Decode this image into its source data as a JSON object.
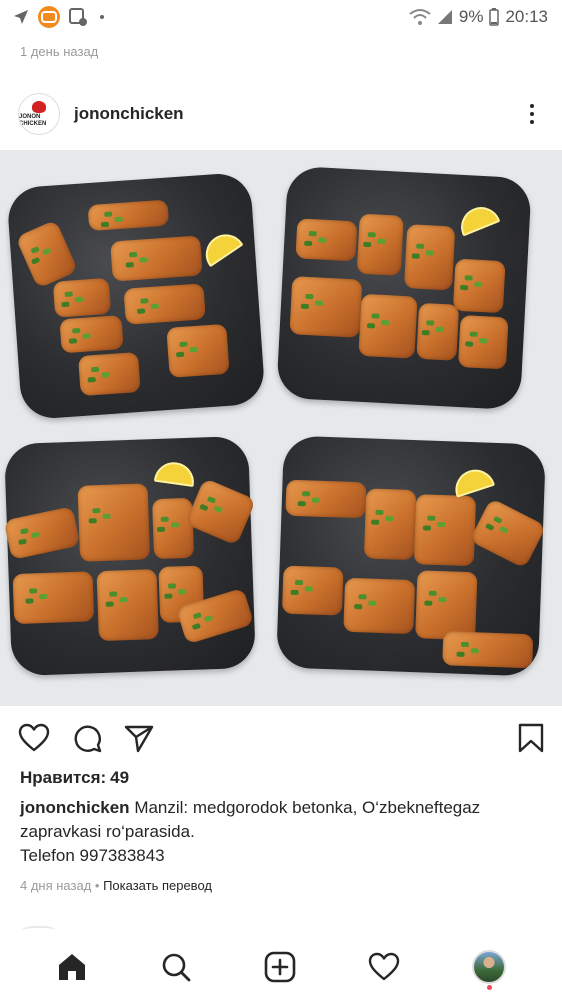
{
  "status_bar": {
    "battery_percent": "9%",
    "time": "20:13"
  },
  "previous_post": {
    "time_ago": "1 день назад"
  },
  "post": {
    "username": "jononchicken",
    "avatar_text": "JONON CHICKEN",
    "likes_label": "Нравится:",
    "likes_count": "49",
    "caption_user": "jononchicken",
    "caption_line1": "Manzil: medgorodok betonka, O‘zbekneftegaz zapravkasi ro‘parasida.",
    "caption_line2": "Telefon 997383843",
    "time_ago": "4 дня назад",
    "separator": " • ",
    "translate_link": "Показать перевод",
    "image_subject": "four dark plates of grilled chicken pieces with lemon slices and herbs"
  },
  "icons": {
    "location": "location-arrow-icon",
    "ok": "odnoklassniki-icon",
    "screenshot": "screenshot-icon",
    "wifi": "wifi-icon",
    "signal": "signal-icon",
    "battery": "battery-icon",
    "more": "more-vertical-icon",
    "like": "heart-icon",
    "comment": "comment-icon",
    "share": "paper-plane-icon",
    "save": "bookmark-icon",
    "home": "home-icon",
    "search": "search-icon",
    "new_post": "plus-square-icon",
    "activity": "heart-icon",
    "profile": "profile-avatar"
  },
  "colors": {
    "text": "#262626",
    "meta": "#9a9a9a",
    "notification_dot": "#ed4956",
    "ok_badge": "#f28a1e"
  }
}
